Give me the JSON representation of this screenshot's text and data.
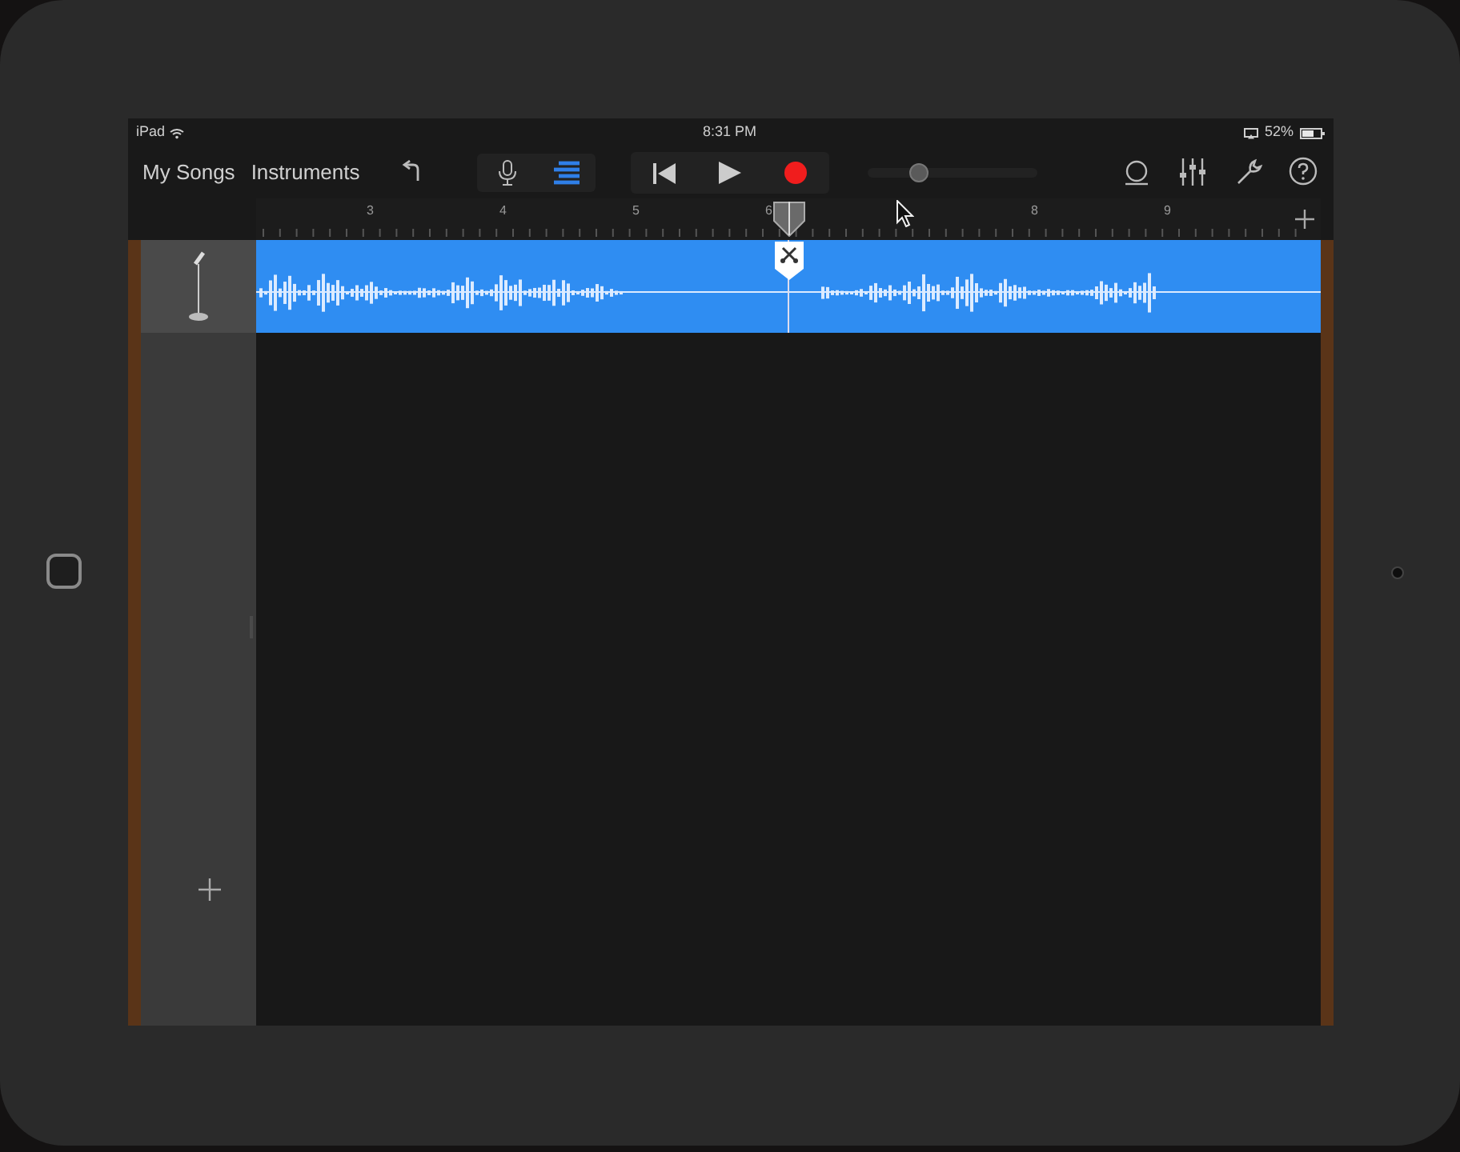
{
  "status_bar": {
    "device": "iPad",
    "time": "8:31 PM",
    "battery": "52%"
  },
  "toolbar": {
    "nav": [
      "My Songs",
      "Instruments"
    ],
    "view_buttons": [
      {
        "kind": "mic",
        "selected": false
      },
      {
        "kind": "tracks",
        "selected": true
      }
    ],
    "volume": {
      "level": 0.3
    }
  },
  "ruler": {
    "labels": [
      "3",
      "4",
      "5",
      "6",
      "8",
      "9"
    ]
  },
  "tracks": [
    {
      "kind": "audio",
      "selected": true
    }
  ]
}
